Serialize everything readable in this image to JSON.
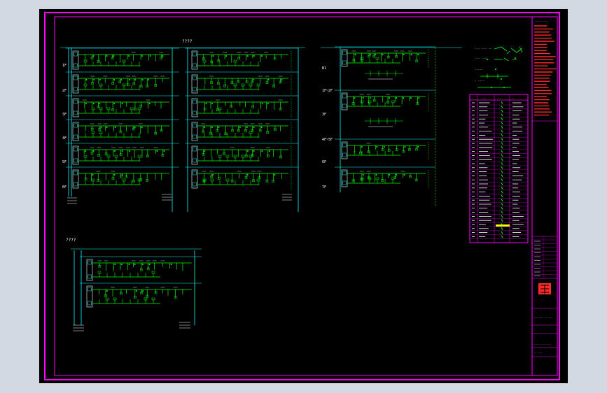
{
  "drawing": {
    "section_labels": [
      "????",
      "????"
    ],
    "row_labels_left": [
      "1F",
      "2F",
      "3F",
      "4F",
      "5F",
      "6F"
    ],
    "row_labels_mid": [
      "B1",
      "1F~2F",
      "3F",
      "4F~5F",
      "6F",
      "7F"
    ],
    "legend_labels": [
      "--- --- --",
      "--- ---",
      "-----",
      "- ----"
    ],
    "table_header": [
      "--",
      "-----",
      "----",
      "--"
    ],
    "title_block": {
      "header": "---- ----",
      "stamp_text": "--- -----",
      "drawing_title": "------ ------",
      "drawing_no": "----- --- ----",
      "scale": "-- ----"
    }
  },
  "colors": {
    "background": "#d3d9e3",
    "sheet": "#000000",
    "frame": "#ff00ff",
    "riser": "#00ffff",
    "circuit": "#00ff00",
    "text": "#ffffff",
    "notes": "#ff2a2a"
  }
}
